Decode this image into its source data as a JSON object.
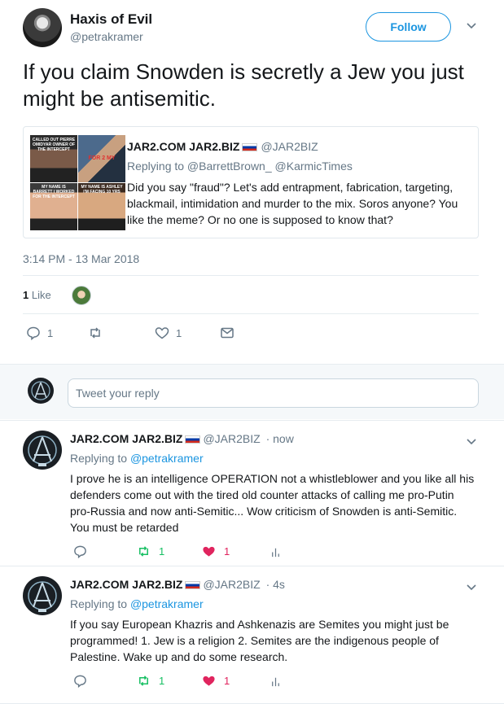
{
  "tweet": {
    "author": {
      "display_name": "Haxis of Evil",
      "handle": "@petrakramer"
    },
    "follow_label": "Follow",
    "text": "If you claim Snowden is secretly a Jew you just might be antisemitic.",
    "quoted": {
      "name": "JAR2.COM JAR2.BIZ",
      "handle": "@JAR2BIZ",
      "replying_to": "Replying to @BarrettBrown_ @KarmicTimes",
      "text": "Did you say \"fraud\"? Let's add entrapment, fabrication, targeting, blackmail, intimidation and murder to the mix. Soros anyone? You like the meme? Or no one is supposed to know that?",
      "media_captions": [
        "CALLED OUT PIERRE OMIDYAR OWNER OF THE INTERCEPT",
        "FOR 2 MY",
        "MY NAME IS BARRETT I WORKED FOR THE INTERCEPT",
        "MY NAME IS ASHLEY I'M FACING 10 YRS"
      ]
    },
    "timestamp": "3:14 PM - 13 Mar 2018",
    "likes_count": "1",
    "likes_label": "Like",
    "actions": {
      "replies": "1",
      "retweets": "",
      "likes": "1"
    }
  },
  "reply_box": {
    "placeholder": "Tweet your reply"
  },
  "replies": [
    {
      "name": "JAR2.COM JAR2.BIZ",
      "handle": "@JAR2BIZ",
      "time": "· now",
      "replying_prefix": "Replying to ",
      "replying_to": "@petrakramer",
      "text": "I prove he is an intelligence OPERATION not a whistleblower and you like all his defenders come out with the tired old counter attacks of calling me pro-Putin pro-Russia and now anti-Semitic... Wow criticism of Snowden is anti-Semitic. You must be retarded",
      "retweets": "1",
      "likes": "1"
    },
    {
      "name": "JAR2.COM JAR2.BIZ",
      "handle": "@JAR2BIZ",
      "time": "· 4s",
      "replying_prefix": "Replying to ",
      "replying_to": "@petrakramer",
      "text": "If you say European Khazris and Ashkenazis are Semites you might just be programmed! 1. Jew is a religion 2. Semites are the indigenous people of Palestine. Wake up and do some research.",
      "retweets": "1",
      "likes": "1"
    }
  ],
  "colors": {
    "accent": "#1b95e0",
    "retweet": "#17bf63",
    "like": "#e0245e",
    "muted": "#657786"
  }
}
